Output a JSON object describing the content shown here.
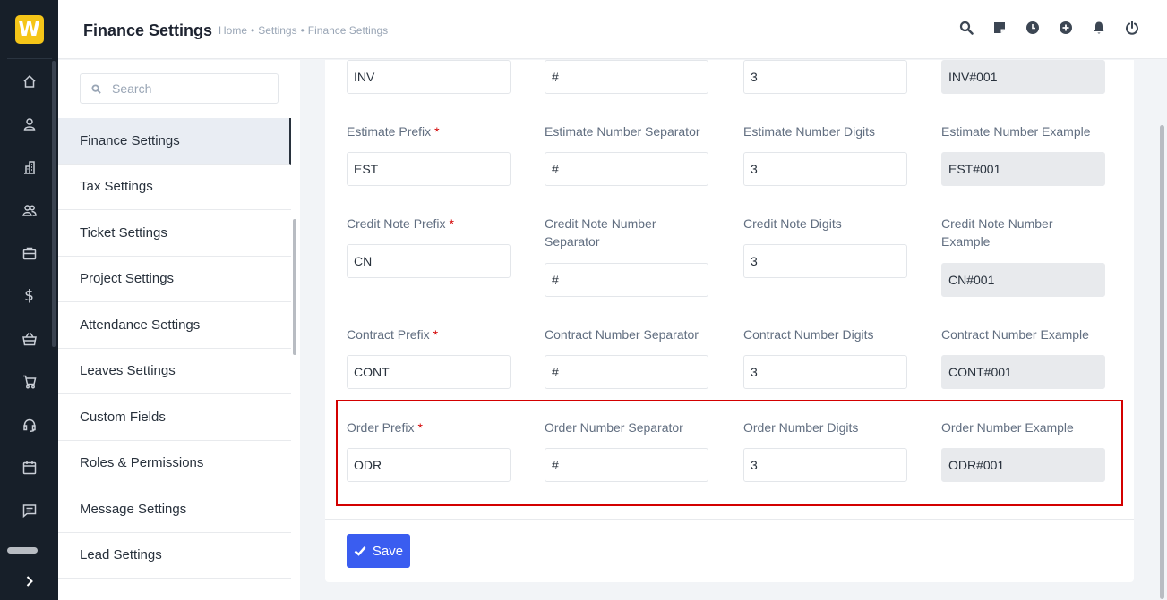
{
  "header": {
    "title": "Finance Settings",
    "breadcrumb": [
      "Home",
      "Settings",
      "Finance Settings"
    ],
    "separator": "•",
    "icons": [
      "search-icon",
      "sticky-note-icon",
      "clock-icon",
      "add-circle-icon",
      "bell-icon",
      "power-icon"
    ]
  },
  "rail": {
    "logo": "W",
    "items": [
      "home-icon",
      "user-icon",
      "building-icon",
      "users-icon",
      "briefcase-icon",
      "dollar-icon",
      "basket-icon",
      "cart-icon",
      "headset-icon",
      "calendar-icon",
      "message-icon"
    ],
    "dollar_glyph": "$"
  },
  "settings_menu": {
    "search_placeholder": "Search",
    "items": [
      {
        "label": "Finance Settings",
        "active": true
      },
      {
        "label": "Tax Settings"
      },
      {
        "label": "Ticket Settings"
      },
      {
        "label": "Project Settings"
      },
      {
        "label": "Attendance Settings"
      },
      {
        "label": "Leaves Settings"
      },
      {
        "label": "Custom Fields"
      },
      {
        "label": "Roles & Permissions"
      },
      {
        "label": "Message Settings"
      },
      {
        "label": "Lead Settings"
      }
    ]
  },
  "form": {
    "required_mark": "*",
    "invoice": {
      "prefix_value": "INV",
      "separator_value": "#",
      "digits_value": "3",
      "example_value": "INV#001"
    },
    "estimate": {
      "prefix_label": "Estimate Prefix",
      "separator_label": "Estimate Number Separator",
      "digits_label": "Estimate Number Digits",
      "example_label": "Estimate Number Example",
      "prefix_value": "EST",
      "separator_value": "#",
      "digits_value": "3",
      "example_value": "EST#001"
    },
    "credit_note": {
      "prefix_label": "Credit Note Prefix",
      "separator_label_1": "Credit Note Number",
      "separator_label_2": "Separator",
      "digits_label": "Credit Note Digits",
      "example_label_1": "Credit Note Number",
      "example_label_2": "Example",
      "prefix_value": "CN",
      "separator_value": "#",
      "digits_value": "3",
      "example_value": "CN#001"
    },
    "contract": {
      "prefix_label": "Contract Prefix",
      "separator_label": "Contract Number Separator",
      "digits_label": "Contract Number Digits",
      "example_label": "Contract Number Example",
      "prefix_value": "CONT",
      "separator_value": "#",
      "digits_value": "3",
      "example_value": "CONT#001"
    },
    "order": {
      "prefix_label": "Order Prefix",
      "separator_label": "Order Number Separator",
      "digits_label": "Order Number Digits",
      "example_label": "Order Number Example",
      "prefix_value": "ODR",
      "separator_value": "#",
      "digits_value": "3",
      "example_value": "ODR#001"
    },
    "save_label": "Save"
  },
  "colors": {
    "rail_bg": "#171f29",
    "accent": "#3a5df0",
    "logo": "#f5c518",
    "highlight_border": "#d30000"
  }
}
